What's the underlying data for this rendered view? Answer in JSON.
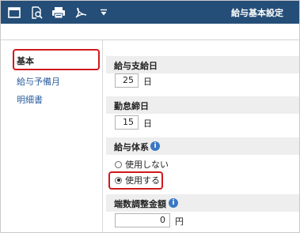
{
  "toolbar": {
    "title": "給与基本設定",
    "icons": [
      "window-icon",
      "search-document-icon",
      "print-icon",
      "pdf-icon",
      "dropdown-icon"
    ]
  },
  "sidebar": {
    "items": [
      {
        "label": "基本",
        "active": true
      },
      {
        "label": "給与予備月",
        "active": false
      },
      {
        "label": "明細書",
        "active": false
      }
    ]
  },
  "sections": {
    "pay_day": {
      "title": "給与支給日",
      "value": "25",
      "unit": "日"
    },
    "cutoff_day": {
      "title": "勤怠締日",
      "value": "15",
      "unit": "日"
    },
    "pay_system": {
      "title": "給与体系",
      "options": [
        {
          "label": "使用しない",
          "selected": false
        },
        {
          "label": "使用する",
          "selected": true
        }
      ]
    },
    "rounding": {
      "title": "端数調整金額",
      "value": "0",
      "unit": "円"
    }
  },
  "colors": {
    "toolbar_bg": "#244e78",
    "highlight": "#d0191b",
    "link": "#2a5d9f",
    "info": "#3a78c3"
  }
}
